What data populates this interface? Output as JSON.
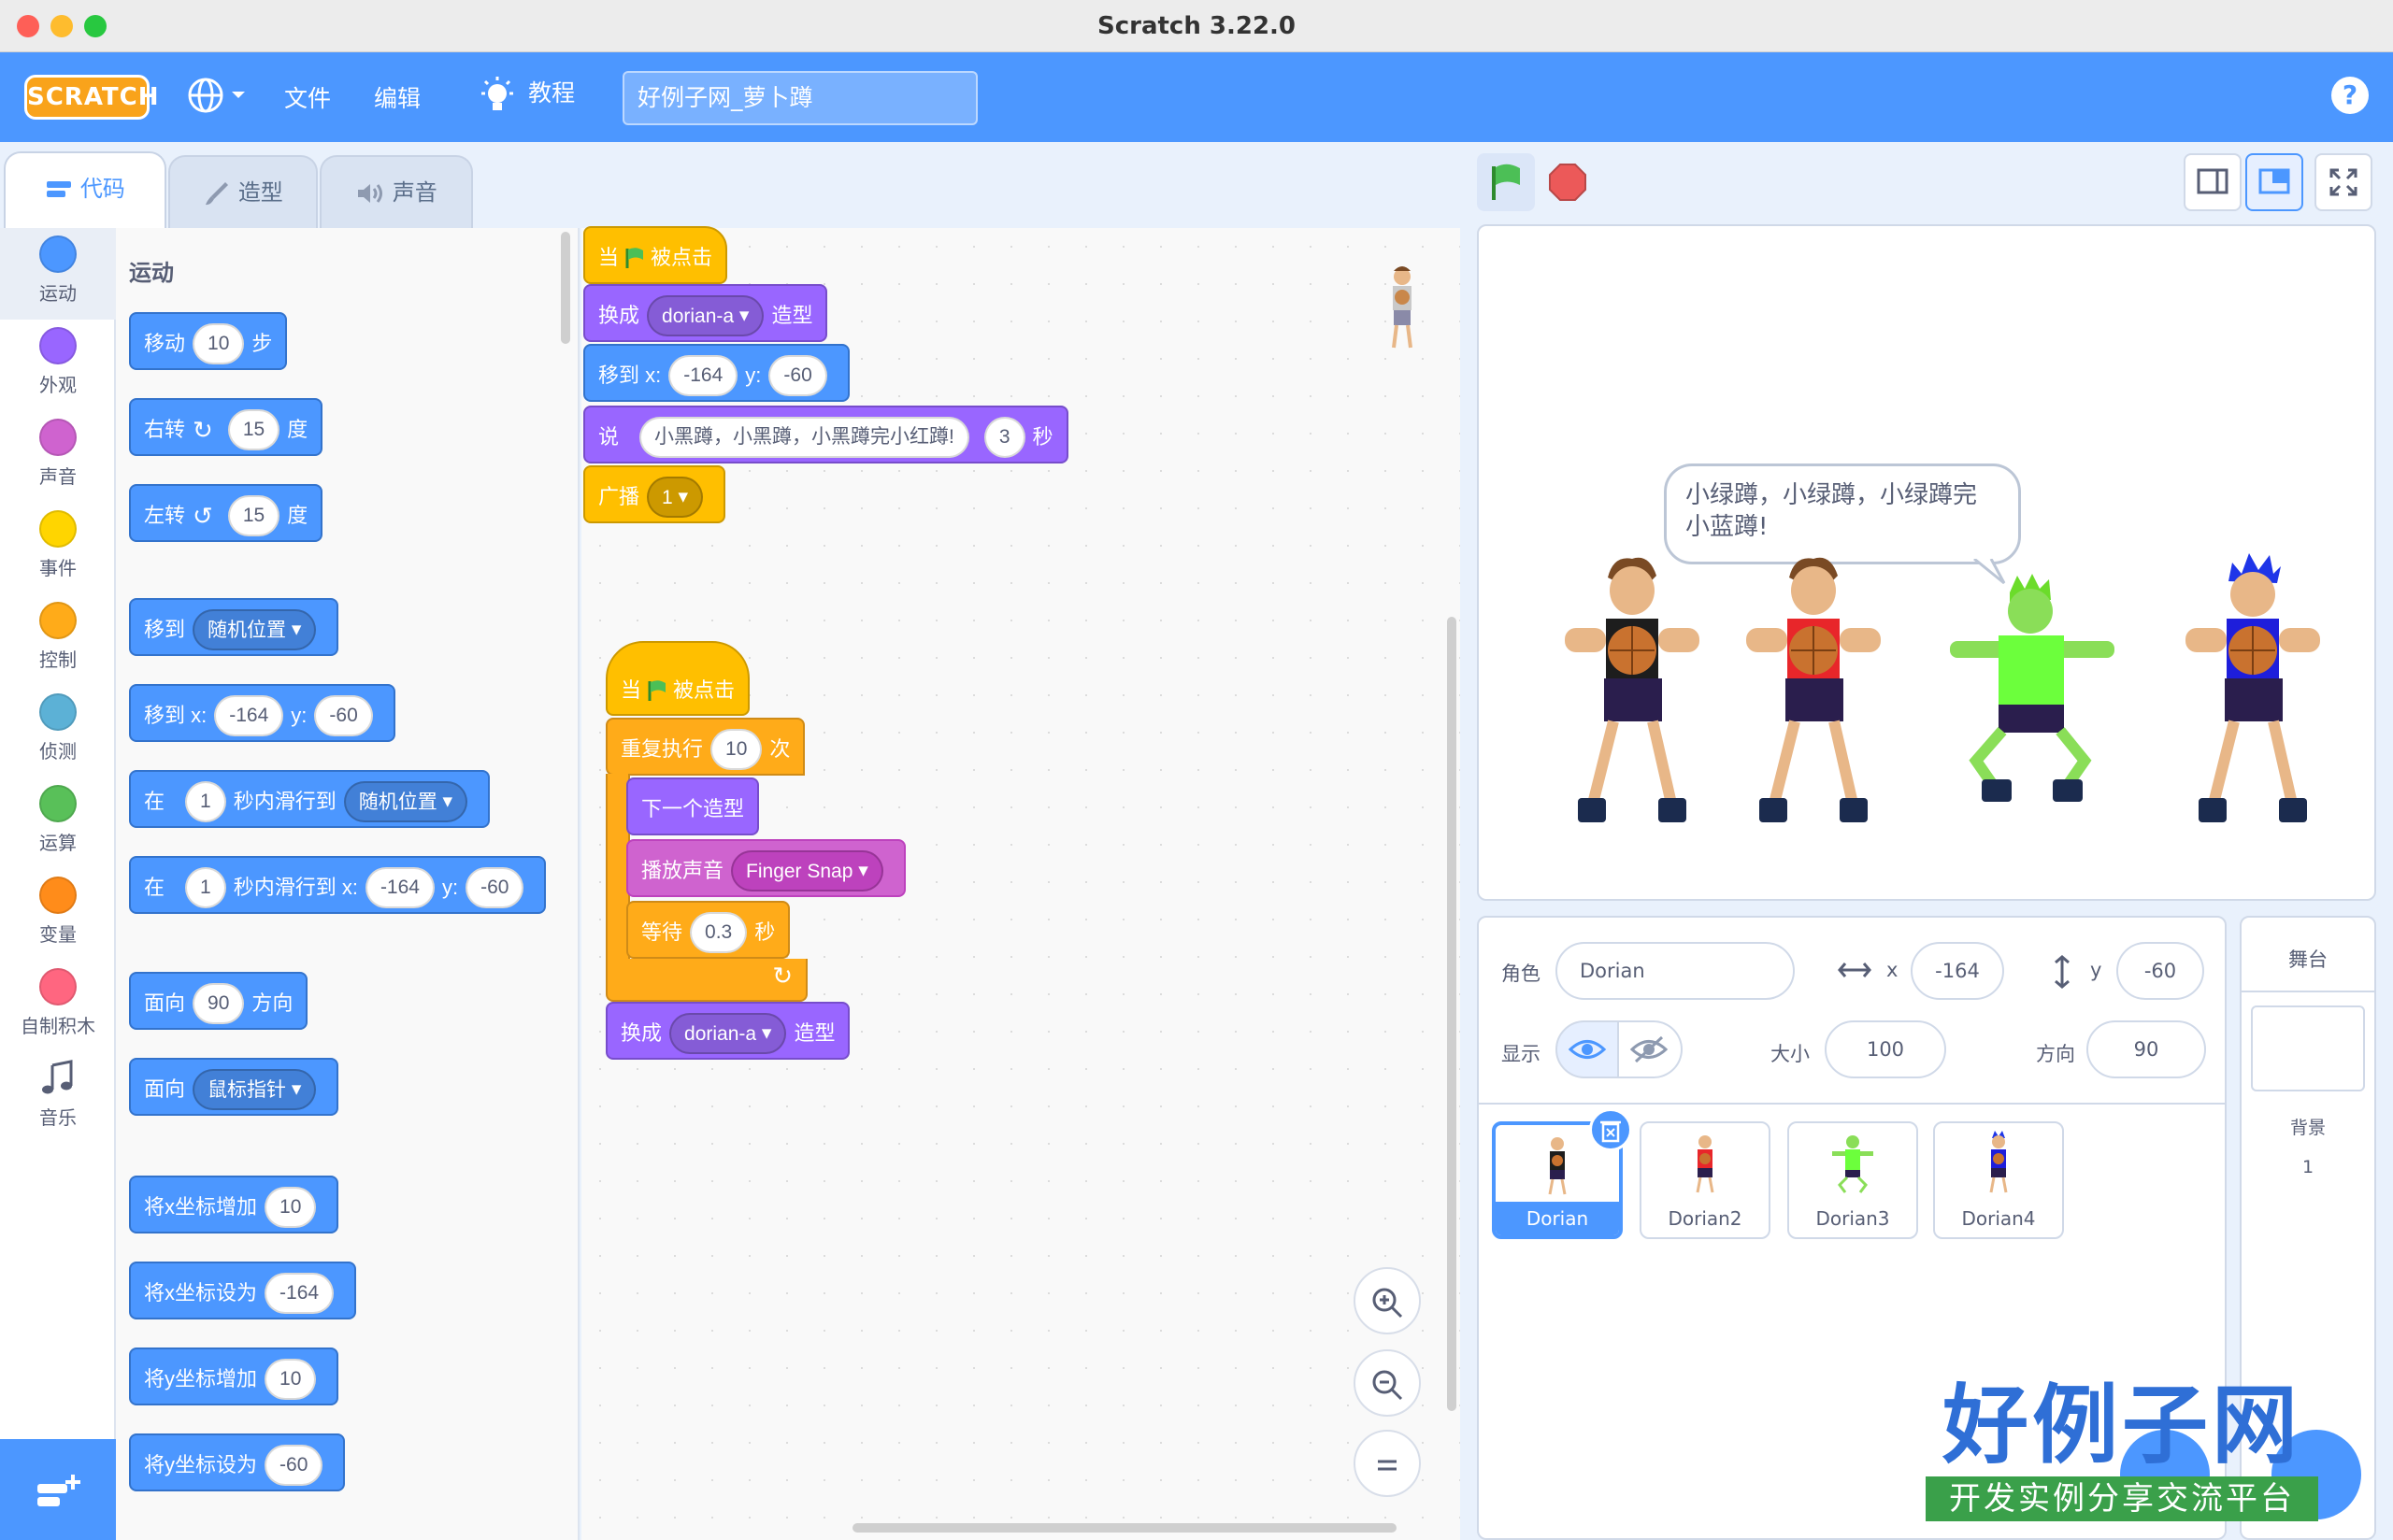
{
  "window": {
    "title": "Scratch 3.22.0"
  },
  "menubar": {
    "logo": "SCRATCH",
    "file": "文件",
    "edit": "编辑",
    "tutorials": "教程",
    "project_title": "好例子网_萝卜蹲",
    "help": "?"
  },
  "tabs": [
    "代码",
    "造型",
    "声音"
  ],
  "categories": [
    {
      "label": "运动",
      "color": "#4c97ff"
    },
    {
      "label": "外观",
      "color": "#9966ff"
    },
    {
      "label": "声音",
      "color": "#cf63cf"
    },
    {
      "label": "事件",
      "color": "#ffd500"
    },
    {
      "label": "控制",
      "color": "#ffab19"
    },
    {
      "label": "侦测",
      "color": "#5cb1d6"
    },
    {
      "label": "运算",
      "color": "#59c059"
    },
    {
      "label": "变量",
      "color": "#ff8c1a"
    },
    {
      "label": "自制积木",
      "color": "#ff6680"
    },
    {
      "label": "音乐",
      "color": "#0fbd8c"
    }
  ],
  "palette": {
    "heading": "运动",
    "move": {
      "a": "移动",
      "v": "10",
      "b": "步"
    },
    "turn_right": {
      "a": "右转",
      "v": "15",
      "b": "度"
    },
    "turn_left": {
      "a": "左转",
      "v": "15",
      "b": "度"
    },
    "goto": {
      "a": "移到",
      "d": "随机位置"
    },
    "goto_xy": {
      "a": "移到 x:",
      "x": "-164",
      "b": "y:",
      "y": "-60"
    },
    "glide": {
      "a": "在",
      "v": "1",
      "b": "秒内滑行到",
      "d": "随机位置"
    },
    "glide_xy": {
      "a": "在",
      "v": "1",
      "b": "秒内滑行到 x:",
      "x": "-164",
      "c": "y:",
      "y": "-60"
    },
    "point_dir": {
      "a": "面向",
      "v": "90",
      "b": "方向"
    },
    "point_towards": {
      "a": "面向",
      "d": "鼠标指针"
    },
    "change_x": {
      "a": "将x坐标增加",
      "v": "10"
    },
    "set_x": {
      "a": "将x坐标设为",
      "v": "-164"
    },
    "change_y": {
      "a": "将y坐标增加",
      "v": "10"
    },
    "set_y": {
      "a": "将y坐标设为",
      "v": "-60"
    }
  },
  "script1": {
    "hat": {
      "a": "当",
      "b": "被点击"
    },
    "costume": {
      "a": "换成",
      "d": "dorian-a",
      "b": "造型"
    },
    "goto": {
      "a": "移到 x:",
      "x": "-164",
      "b": "y:",
      "y": "-60"
    },
    "say": {
      "a": "说",
      "text": "小黑蹲，小黑蹲，小黑蹲完小红蹲!",
      "secs": "3",
      "b": "秒"
    },
    "broadcast": {
      "a": "广播",
      "d": "1"
    }
  },
  "script2": {
    "hat": {
      "a": "当",
      "b": "被点击"
    },
    "repeat": {
      "a": "重复执行",
      "v": "10",
      "b": "次"
    },
    "next_costume": "下一个造型",
    "sound": {
      "a": "播放声音",
      "d": "Finger Snap"
    },
    "wait": {
      "a": "等待",
      "v": "0.3",
      "b": "秒"
    },
    "costume": {
      "a": "换成",
      "d": "dorian-a",
      "b": "造型"
    }
  },
  "stage": {
    "bubble": "小绿蹲，小绿蹲，小绿蹲完小蓝蹲!"
  },
  "sprite_info": {
    "sprite_label": "角色",
    "name": "Dorian",
    "x_label": "x",
    "x": "-164",
    "y_label": "y",
    "y": "-60",
    "show_label": "显示",
    "size_label": "大小",
    "size": "100",
    "dir_label": "方向",
    "dir": "90"
  },
  "sprites": [
    "Dorian",
    "Dorian2",
    "Dorian3",
    "Dorian4"
  ],
  "stage_pane": {
    "title": "舞台",
    "backdrop_label": "背景",
    "backdrop_count": "1"
  },
  "watermark": {
    "big": "好例子网",
    "small": "开发实例分享交流平台"
  }
}
